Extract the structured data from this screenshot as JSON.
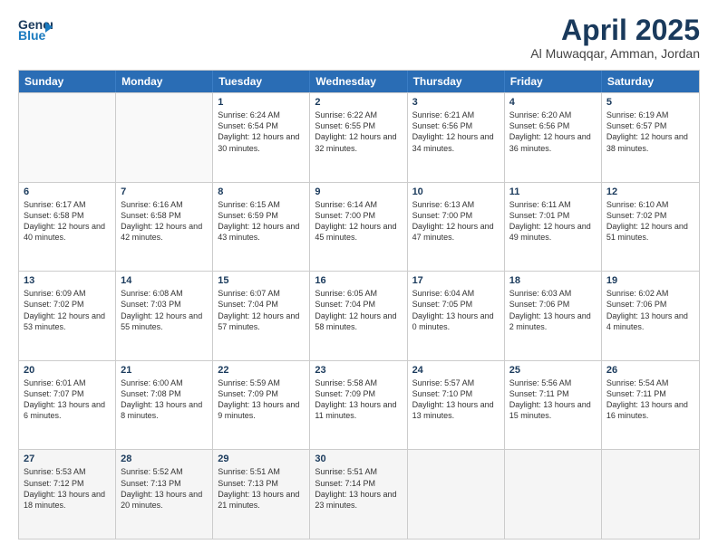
{
  "header": {
    "logo_line1": "General",
    "logo_line2": "Blue",
    "month_title": "April 2025",
    "location": "Al Muwaqqar, Amman, Jordan"
  },
  "weekdays": [
    "Sunday",
    "Monday",
    "Tuesday",
    "Wednesday",
    "Thursday",
    "Friday",
    "Saturday"
  ],
  "rows": [
    [
      {
        "day": "",
        "sunrise": "",
        "sunset": "",
        "daylight": "",
        "empty": true
      },
      {
        "day": "",
        "sunrise": "",
        "sunset": "",
        "daylight": "",
        "empty": true
      },
      {
        "day": "1",
        "sunrise": "Sunrise: 6:24 AM",
        "sunset": "Sunset: 6:54 PM",
        "daylight": "Daylight: 12 hours and 30 minutes."
      },
      {
        "day": "2",
        "sunrise": "Sunrise: 6:22 AM",
        "sunset": "Sunset: 6:55 PM",
        "daylight": "Daylight: 12 hours and 32 minutes."
      },
      {
        "day": "3",
        "sunrise": "Sunrise: 6:21 AM",
        "sunset": "Sunset: 6:56 PM",
        "daylight": "Daylight: 12 hours and 34 minutes."
      },
      {
        "day": "4",
        "sunrise": "Sunrise: 6:20 AM",
        "sunset": "Sunset: 6:56 PM",
        "daylight": "Daylight: 12 hours and 36 minutes."
      },
      {
        "day": "5",
        "sunrise": "Sunrise: 6:19 AM",
        "sunset": "Sunset: 6:57 PM",
        "daylight": "Daylight: 12 hours and 38 minutes."
      }
    ],
    [
      {
        "day": "6",
        "sunrise": "Sunrise: 6:17 AM",
        "sunset": "Sunset: 6:58 PM",
        "daylight": "Daylight: 12 hours and 40 minutes."
      },
      {
        "day": "7",
        "sunrise": "Sunrise: 6:16 AM",
        "sunset": "Sunset: 6:58 PM",
        "daylight": "Daylight: 12 hours and 42 minutes."
      },
      {
        "day": "8",
        "sunrise": "Sunrise: 6:15 AM",
        "sunset": "Sunset: 6:59 PM",
        "daylight": "Daylight: 12 hours and 43 minutes."
      },
      {
        "day": "9",
        "sunrise": "Sunrise: 6:14 AM",
        "sunset": "Sunset: 7:00 PM",
        "daylight": "Daylight: 12 hours and 45 minutes."
      },
      {
        "day": "10",
        "sunrise": "Sunrise: 6:13 AM",
        "sunset": "Sunset: 7:00 PM",
        "daylight": "Daylight: 12 hours and 47 minutes."
      },
      {
        "day": "11",
        "sunrise": "Sunrise: 6:11 AM",
        "sunset": "Sunset: 7:01 PM",
        "daylight": "Daylight: 12 hours and 49 minutes."
      },
      {
        "day": "12",
        "sunrise": "Sunrise: 6:10 AM",
        "sunset": "Sunset: 7:02 PM",
        "daylight": "Daylight: 12 hours and 51 minutes."
      }
    ],
    [
      {
        "day": "13",
        "sunrise": "Sunrise: 6:09 AM",
        "sunset": "Sunset: 7:02 PM",
        "daylight": "Daylight: 12 hours and 53 minutes."
      },
      {
        "day": "14",
        "sunrise": "Sunrise: 6:08 AM",
        "sunset": "Sunset: 7:03 PM",
        "daylight": "Daylight: 12 hours and 55 minutes."
      },
      {
        "day": "15",
        "sunrise": "Sunrise: 6:07 AM",
        "sunset": "Sunset: 7:04 PM",
        "daylight": "Daylight: 12 hours and 57 minutes."
      },
      {
        "day": "16",
        "sunrise": "Sunrise: 6:05 AM",
        "sunset": "Sunset: 7:04 PM",
        "daylight": "Daylight: 12 hours and 58 minutes."
      },
      {
        "day": "17",
        "sunrise": "Sunrise: 6:04 AM",
        "sunset": "Sunset: 7:05 PM",
        "daylight": "Daylight: 13 hours and 0 minutes."
      },
      {
        "day": "18",
        "sunrise": "Sunrise: 6:03 AM",
        "sunset": "Sunset: 7:06 PM",
        "daylight": "Daylight: 13 hours and 2 minutes."
      },
      {
        "day": "19",
        "sunrise": "Sunrise: 6:02 AM",
        "sunset": "Sunset: 7:06 PM",
        "daylight": "Daylight: 13 hours and 4 minutes."
      }
    ],
    [
      {
        "day": "20",
        "sunrise": "Sunrise: 6:01 AM",
        "sunset": "Sunset: 7:07 PM",
        "daylight": "Daylight: 13 hours and 6 minutes."
      },
      {
        "day": "21",
        "sunrise": "Sunrise: 6:00 AM",
        "sunset": "Sunset: 7:08 PM",
        "daylight": "Daylight: 13 hours and 8 minutes."
      },
      {
        "day": "22",
        "sunrise": "Sunrise: 5:59 AM",
        "sunset": "Sunset: 7:09 PM",
        "daylight": "Daylight: 13 hours and 9 minutes."
      },
      {
        "day": "23",
        "sunrise": "Sunrise: 5:58 AM",
        "sunset": "Sunset: 7:09 PM",
        "daylight": "Daylight: 13 hours and 11 minutes."
      },
      {
        "day": "24",
        "sunrise": "Sunrise: 5:57 AM",
        "sunset": "Sunset: 7:10 PM",
        "daylight": "Daylight: 13 hours and 13 minutes."
      },
      {
        "day": "25",
        "sunrise": "Sunrise: 5:56 AM",
        "sunset": "Sunset: 7:11 PM",
        "daylight": "Daylight: 13 hours and 15 minutes."
      },
      {
        "day": "26",
        "sunrise": "Sunrise: 5:54 AM",
        "sunset": "Sunset: 7:11 PM",
        "daylight": "Daylight: 13 hours and 16 minutes."
      }
    ],
    [
      {
        "day": "27",
        "sunrise": "Sunrise: 5:53 AM",
        "sunset": "Sunset: 7:12 PM",
        "daylight": "Daylight: 13 hours and 18 minutes."
      },
      {
        "day": "28",
        "sunrise": "Sunrise: 5:52 AM",
        "sunset": "Sunset: 7:13 PM",
        "daylight": "Daylight: 13 hours and 20 minutes."
      },
      {
        "day": "29",
        "sunrise": "Sunrise: 5:51 AM",
        "sunset": "Sunset: 7:13 PM",
        "daylight": "Daylight: 13 hours and 21 minutes."
      },
      {
        "day": "30",
        "sunrise": "Sunrise: 5:51 AM",
        "sunset": "Sunset: 7:14 PM",
        "daylight": "Daylight: 13 hours and 23 minutes."
      },
      {
        "day": "",
        "sunrise": "",
        "sunset": "",
        "daylight": "",
        "empty": true
      },
      {
        "day": "",
        "sunrise": "",
        "sunset": "",
        "daylight": "",
        "empty": true
      },
      {
        "day": "",
        "sunrise": "",
        "sunset": "",
        "daylight": "",
        "empty": true
      }
    ]
  ]
}
